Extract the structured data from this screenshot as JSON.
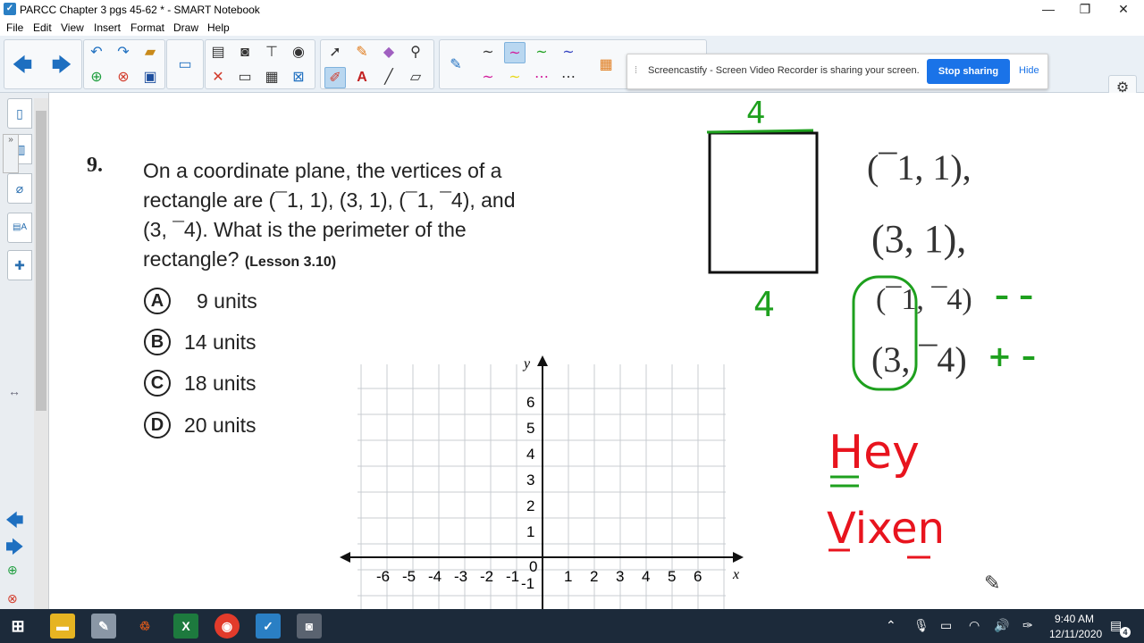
{
  "window": {
    "title": "PARCC Chapter 3 pgs 45-62 * - SMART Notebook",
    "app_icon_glyph": "✓",
    "minimize": "—",
    "restore": "❐",
    "close": "✕"
  },
  "menu": [
    "File",
    "Edit",
    "View",
    "Insert",
    "Format",
    "Draw",
    "Help"
  ],
  "screencastify": {
    "message": "Screencastify - Screen Video Recorder is sharing your screen.",
    "stop_label": "Stop sharing",
    "hide_label": "Hide",
    "accent": "#1a73e8"
  },
  "question": {
    "number": "9.",
    "line1": "On a coordinate plane, the vertices of a",
    "line2": "rectangle are (¯1, 1), (3, 1), (¯1, ¯4), and",
    "line3": "(3, ¯4). What is the perimeter of the",
    "line4": "rectangle?",
    "lesson": "(Lesson 3.10)",
    "choices": [
      {
        "letter": "A",
        "text": "9 units"
      },
      {
        "letter": "B",
        "text": "14 units"
      },
      {
        "letter": "C",
        "text": "18 units"
      },
      {
        "letter": "D",
        "text": "20 units"
      }
    ]
  },
  "graph": {
    "y_label": "y",
    "x_label": "x",
    "origin_label": "0",
    "x_ticks": [
      "-6",
      "-5",
      "-4",
      "-3",
      "-2",
      "-1",
      "1",
      "2",
      "3",
      "4",
      "5",
      "6"
    ],
    "y_ticks": [
      "6",
      "5",
      "4",
      "3",
      "2",
      "1",
      "-1"
    ]
  },
  "annotations": {
    "top_side": "4",
    "bottom_side": "4",
    "coords": [
      "(¯1, 1),",
      "(3, 1),",
      "(¯1, ¯4)",
      "(3, ¯4)"
    ],
    "signs_a": "– –",
    "signs_b": "+ –",
    "hey": "Hey",
    "vixen": "Vixen",
    "green": "#1ea01e",
    "red": "#e8141e"
  },
  "taskbar": {
    "time": "9:40 AM",
    "date": "12/11/2020",
    "notification_count": "4"
  }
}
